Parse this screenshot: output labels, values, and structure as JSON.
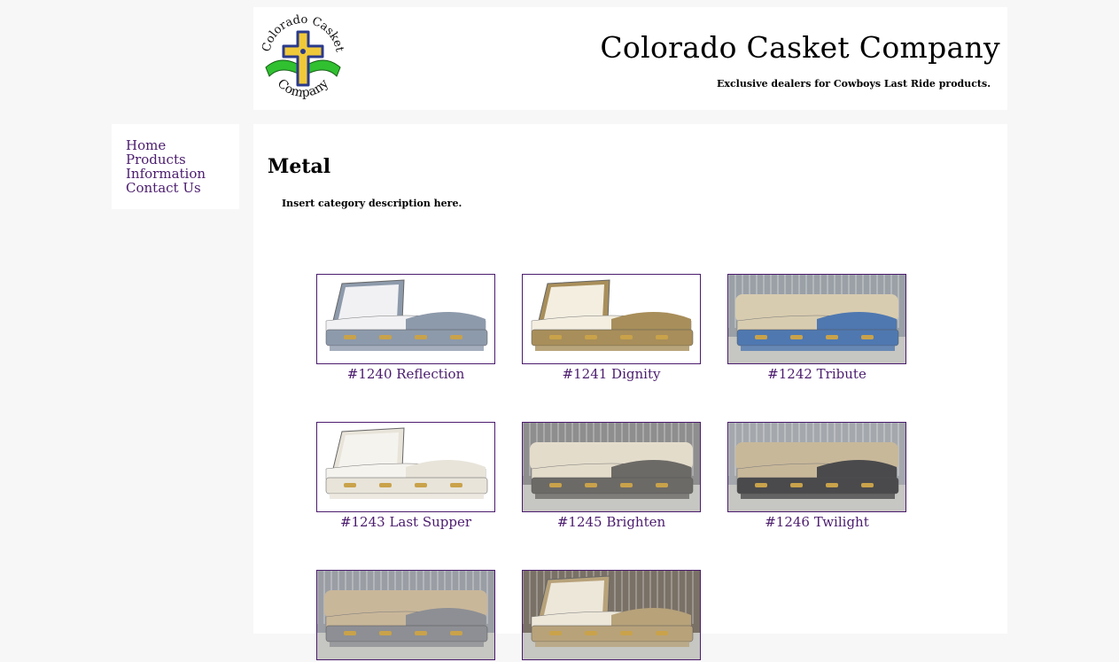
{
  "header": {
    "logo_text_top": "Colorado Casket",
    "logo_text_bottom": "Company",
    "title": "Colorado Casket Company",
    "tagline": "Exclusive dealers for Cowboys Last Ride products."
  },
  "nav": [
    "Home",
    "Products",
    "Information",
    "Contact Us"
  ],
  "category": {
    "heading": "Metal",
    "description": "Insert category description here."
  },
  "products": [
    {
      "label": "#1240 Reflection",
      "color": "#8d9aab",
      "interior": "#f1f1f4",
      "bg": "#ffffff",
      "cover": false
    },
    {
      "label": "#1241 Dignity",
      "color": "#a88e5a",
      "interior": "#f3eee0",
      "bg": "#ffffff",
      "cover": false
    },
    {
      "label": "#1242 Tribute",
      "color": "#4f78b0",
      "interior": "#d8ccb0",
      "bg": "#9aa0a6",
      "cover": true
    },
    {
      "label": "#1243 Last Supper",
      "color": "#e8e4da",
      "interior": "#f5f3ee",
      "bg": "#ffffff",
      "cover": false
    },
    {
      "label": "#1245 Brighten",
      "color": "#6c6a66",
      "interior": "#e4dccb",
      "bg": "#8e8e8e",
      "cover": true
    },
    {
      "label": "#1246 Twilight",
      "color": "#4a4a4c",
      "interior": "#c8b89a",
      "bg": "#a4a8ad",
      "cover": true
    },
    {
      "label": "",
      "color": "#8d8f94",
      "interior": "#c9b79a",
      "bg": "#9a9ea4",
      "cover": true
    },
    {
      "label": "",
      "color": "#b7a27a",
      "interior": "#ede7da",
      "bg": "#7a7166",
      "cover": false
    }
  ],
  "logo_image_text": "Colorado Casket Company"
}
